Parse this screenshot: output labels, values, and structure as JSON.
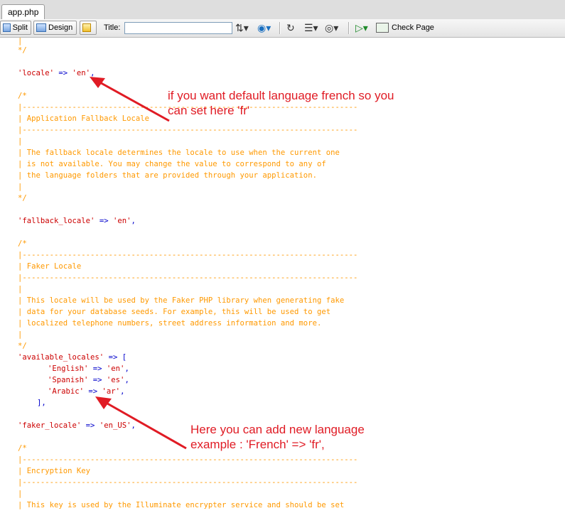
{
  "tab": {
    "label": "app.php"
  },
  "toolbar": {
    "split_label": "Split",
    "design_label": "Design",
    "title_label": "Title:",
    "title_value": "",
    "check_page_label": "Check Page"
  },
  "code": {
    "l1": "|",
    "l2": "*/",
    "locale_key": "'locale'",
    "locale_arrow": " => ",
    "locale_val": "'en'",
    "locale_end": ",",
    "c1": "/*",
    "c2": "|--------------------------------------------------------------------------",
    "c3": "| Application Fallback Locale",
    "c4": "|--------------------------------------------------------------------------",
    "c5": "|",
    "c6": "| The fallback locale determines the locale to use when the current one",
    "c7": "| is not available. You may change the value to correspond to any of",
    "c8": "| the language folders that are provided through your application.",
    "c9": "|",
    "c10": "*/",
    "fb_key": "'fallback_locale'",
    "fb_arrow": " => ",
    "fb_val": "'en'",
    "fb_end": ",",
    "d1": "/*",
    "d2": "|--------------------------------------------------------------------------",
    "d3": "| Faker Locale",
    "d4": "|--------------------------------------------------------------------------",
    "d5": "|",
    "d6": "| This locale will be used by the Faker PHP library when generating fake",
    "d7": "| data for your database seeds. For example, this will be used to get",
    "d8": "| localized telephone numbers, street address information and more.",
    "d9": "|",
    "d10": "*/",
    "al_key": "'available_locales'",
    "al_arrow": " => ",
    "al_open": "[",
    "en_key": "'English'",
    "en_arrow": " => ",
    "en_val": "'en'",
    "en_end": ",",
    "es_key": "'Spanish'",
    "es_arrow": " => ",
    "es_val": "'es'",
    "es_end": ",",
    "ar_key": "'Arabic'",
    "ar_arrow": " => ",
    "ar_val": "'ar'",
    "ar_end": ",",
    "al_close": "],",
    "fk_key": "'faker_locale'",
    "fk_arrow": " => ",
    "fk_val": "'en_US'",
    "fk_end": ",",
    "e1": "/*",
    "e2": "|--------------------------------------------------------------------------",
    "e3": "| Encryption Key",
    "e4": "|--------------------------------------------------------------------------",
    "e5": "|",
    "e6": "| This key is used by the Illuminate encrypter service and should be set"
  },
  "annotations": {
    "top": "if you want default language french so you\ncan set here 'fr'",
    "bottom": "Here you can add new language\nexample : 'French' => 'fr',"
  },
  "colors": {
    "comment": "#ff9900",
    "string": "#cc0000",
    "operator": "#0000cc",
    "annotation": "#e01b24"
  }
}
